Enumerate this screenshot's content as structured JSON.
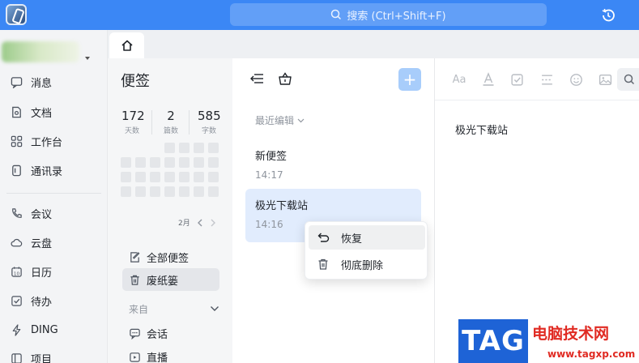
{
  "search": {
    "placeholder_text": "搜索 (Ctrl+Shift+F)"
  },
  "nav": {
    "items": [
      {
        "label": "消息",
        "icon": "message-icon"
      },
      {
        "label": "文档",
        "icon": "document-icon"
      },
      {
        "label": "工作台",
        "icon": "grid-icon"
      },
      {
        "label": "通讯录",
        "icon": "contacts-icon"
      },
      {
        "label": "会议",
        "icon": "phone-icon"
      },
      {
        "label": "云盘",
        "icon": "cloud-icon"
      },
      {
        "label": "日历",
        "icon": "calendar-icon"
      },
      {
        "label": "待办",
        "icon": "todo-icon"
      },
      {
        "label": "DING",
        "icon": "lightning-icon"
      },
      {
        "label": "项目",
        "icon": "project-icon"
      }
    ]
  },
  "notes": {
    "title": "便签",
    "stats": [
      {
        "value": "172",
        "label": "天数"
      },
      {
        "value": "2",
        "label": "篇数"
      },
      {
        "value": "585",
        "label": "字数"
      }
    ],
    "month": "2月",
    "links": [
      {
        "label": "全部便签",
        "icon": "edit-note-icon"
      },
      {
        "label": "废纸篓",
        "icon": "trash-icon"
      }
    ],
    "from_label": "来自",
    "sources": [
      {
        "label": "会话",
        "icon": "chat-icon"
      },
      {
        "label": "直播",
        "icon": "live-icon"
      }
    ]
  },
  "list": {
    "sort_label": "最近编辑",
    "add_symbol": "+",
    "items": [
      {
        "title": "新便签",
        "time": "14:17"
      },
      {
        "title": "极光下载站",
        "time": "14:16"
      }
    ]
  },
  "context_menu": {
    "items": [
      {
        "label": "恢复",
        "icon": "restore-icon"
      },
      {
        "label": "彻底删除",
        "icon": "delete-icon"
      }
    ]
  },
  "editor": {
    "toolbar_font_label": "Aa",
    "content": "极光下载站"
  },
  "watermark": {
    "tag": "TAG",
    "title": "电脑技术网",
    "url": "www.tagxp.com"
  },
  "colors": {
    "accent": "#3b87f5",
    "selected_note": "#e1ecfd",
    "watermark_red": "#e02a22",
    "watermark_blue": "#1e63d6"
  }
}
